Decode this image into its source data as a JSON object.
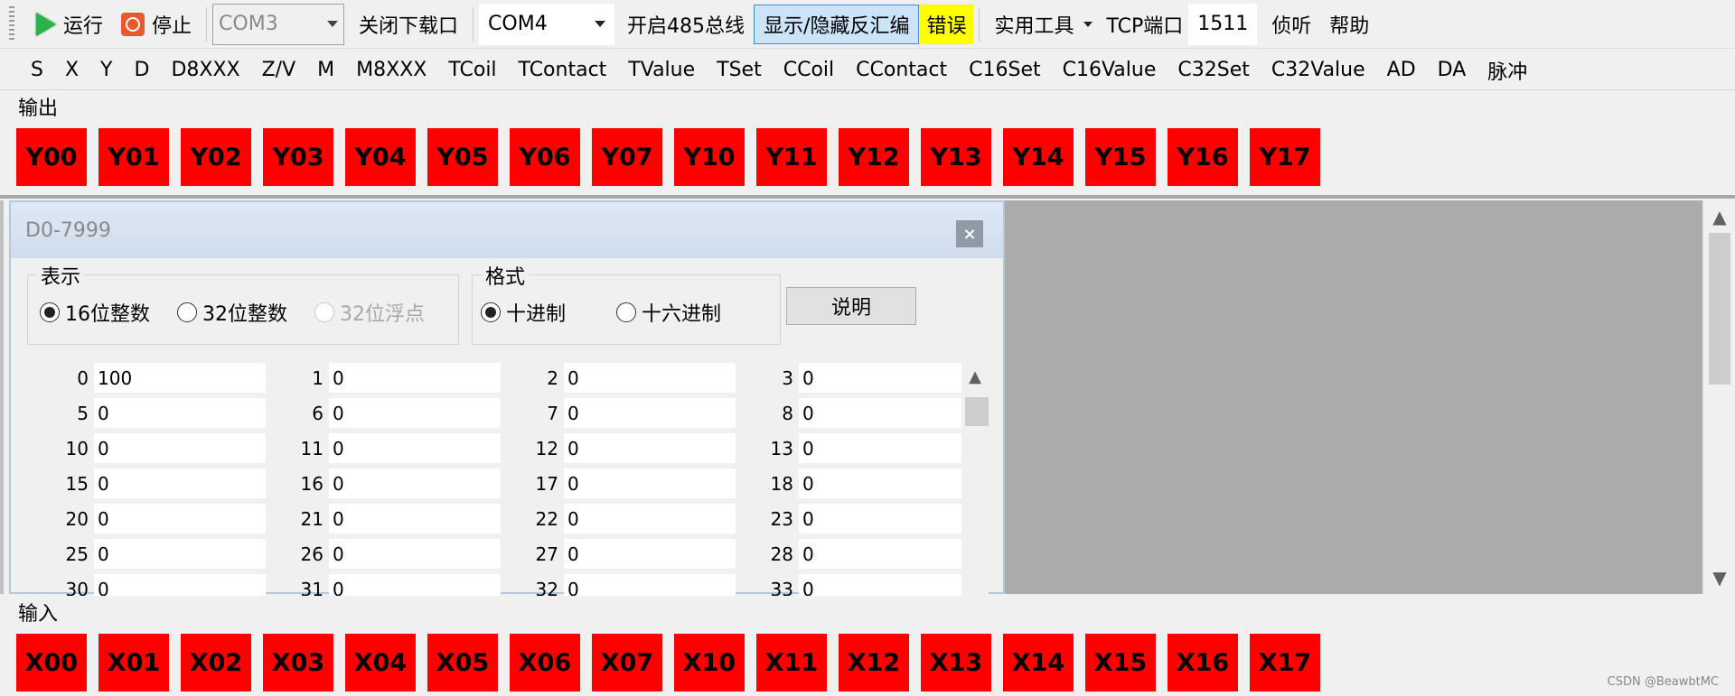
{
  "toolbar": {
    "run_label": "运行",
    "stop_label": "停止",
    "com_disabled": "COM3",
    "close_download_port": "关闭下载口",
    "com_selected": "COM4",
    "open_485": "开启485总线",
    "toggle_disasm": "显示/隐藏反汇编",
    "error_label": "错误",
    "tools_label": "实用工具",
    "tcp_port_label": "TCP端口",
    "tcp_port_value": "1511",
    "listen_label": "侦听",
    "help_label": "帮助",
    "error_color": "#ffff00",
    "pressed_color": "#cce4f7"
  },
  "menu": {
    "items": [
      "S",
      "X",
      "Y",
      "D",
      "D8XXX",
      "Z/V",
      "M",
      "M8XXX",
      "TCoil",
      "TContact",
      "TValue",
      "TSet",
      "CCoil",
      "CContact",
      "C16Set",
      "C16Value",
      "C32Set",
      "C32Value",
      "AD",
      "DA",
      "脉冲"
    ]
  },
  "output": {
    "label": "输出",
    "items": [
      "Y00",
      "Y01",
      "Y02",
      "Y03",
      "Y04",
      "Y05",
      "Y06",
      "Y07",
      "Y10",
      "Y11",
      "Y12",
      "Y13",
      "Y14",
      "Y15",
      "Y16",
      "Y17"
    ],
    "color": "#ff0000"
  },
  "input": {
    "label": "输入",
    "items": [
      "X00",
      "X01",
      "X02",
      "X03",
      "X04",
      "X05",
      "X06",
      "X07",
      "X10",
      "X11",
      "X12",
      "X13",
      "X14",
      "X15",
      "X16",
      "X17"
    ],
    "color": "#ff0000"
  },
  "dwindow": {
    "title": "D0-7999",
    "close_glyph": "×",
    "display_group": {
      "label": "表示",
      "options": [
        "16位整数",
        "32位整数",
        "32位浮点"
      ],
      "selected": "16位整数"
    },
    "format_group": {
      "label": "格式",
      "options": [
        "十进制",
        "十六进制"
      ],
      "selected": "十进制"
    },
    "explain_button": "说明",
    "rows": [
      [
        {
          "i": "0",
          "v": "100"
        },
        {
          "i": "1",
          "v": "0"
        },
        {
          "i": "2",
          "v": "0"
        },
        {
          "i": "3",
          "v": "0"
        }
      ],
      [
        {
          "i": "5",
          "v": "0"
        },
        {
          "i": "6",
          "v": "0"
        },
        {
          "i": "7",
          "v": "0"
        },
        {
          "i": "8",
          "v": "0"
        }
      ],
      [
        {
          "i": "10",
          "v": "0"
        },
        {
          "i": "11",
          "v": "0"
        },
        {
          "i": "12",
          "v": "0"
        },
        {
          "i": "13",
          "v": "0"
        }
      ],
      [
        {
          "i": "15",
          "v": "0"
        },
        {
          "i": "16",
          "v": "0"
        },
        {
          "i": "17",
          "v": "0"
        },
        {
          "i": "18",
          "v": "0"
        }
      ],
      [
        {
          "i": "20",
          "v": "0"
        },
        {
          "i": "21",
          "v": "0"
        },
        {
          "i": "22",
          "v": "0"
        },
        {
          "i": "23",
          "v": "0"
        }
      ],
      [
        {
          "i": "25",
          "v": "0"
        },
        {
          "i": "26",
          "v": "0"
        },
        {
          "i": "27",
          "v": "0"
        },
        {
          "i": "28",
          "v": "0"
        }
      ],
      [
        {
          "i": "30",
          "v": "0"
        },
        {
          "i": "31",
          "v": "0"
        },
        {
          "i": "32",
          "v": "0"
        },
        {
          "i": "33",
          "v": "0"
        }
      ]
    ]
  },
  "icons": {
    "scroll_up": "▲",
    "scroll_down": "▼"
  },
  "watermark": "CSDN @BeawbtMC"
}
